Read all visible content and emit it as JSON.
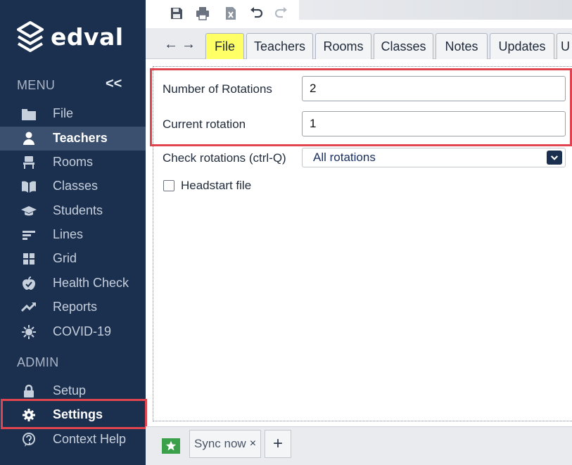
{
  "app": {
    "logo_text": "edval"
  },
  "sidebar": {
    "menu_label": "MENU",
    "collapse_glyph": "<<",
    "admin_label": "ADMIN",
    "items": [
      {
        "label": "File",
        "icon": "folder-icon"
      },
      {
        "label": "Teachers",
        "icon": "person-icon",
        "active": true
      },
      {
        "label": "Rooms",
        "icon": "chair-icon"
      },
      {
        "label": "Classes",
        "icon": "book-icon"
      },
      {
        "label": "Students",
        "icon": "graduation-cap-icon"
      },
      {
        "label": "Lines",
        "icon": "lines-icon"
      },
      {
        "label": "Grid",
        "icon": "grid-icon"
      },
      {
        "label": "Health Check",
        "icon": "apple-icon"
      },
      {
        "label": "Reports",
        "icon": "trend-icon"
      },
      {
        "label": "COVID-19",
        "icon": "virus-icon"
      }
    ],
    "admin_items": [
      {
        "label": "Setup",
        "icon": "lock-icon"
      },
      {
        "label": "Settings",
        "icon": "gear-icon",
        "highlighted": true
      },
      {
        "label": "Context Help",
        "icon": "help-icon"
      }
    ]
  },
  "toolbar": {
    "buttons": [
      "save-icon",
      "print-icon",
      "excel-icon",
      "undo-icon",
      "redo-icon"
    ]
  },
  "tabs": {
    "back_glyph": "←",
    "forward_glyph": "→",
    "items": [
      "File",
      "Teachers",
      "Rooms",
      "Classes",
      "Notes",
      "Updates",
      "U"
    ],
    "active": "File"
  },
  "form": {
    "rotations_label": "Number of Rotations",
    "rotations_value": "2",
    "current_label": "Current rotation",
    "current_value": "1",
    "check_label": "Check rotations (ctrl-Q)",
    "check_value": "All rotations",
    "headstart_label": "Headstart file",
    "headstart_checked": false
  },
  "bottom": {
    "sync_label": "Sync now",
    "sync_close": "×",
    "add_glyph": "+"
  },
  "colors": {
    "sidebar_bg": "#1b2f4f",
    "active_tab": "#ffff66",
    "highlight": "#e0454f"
  }
}
